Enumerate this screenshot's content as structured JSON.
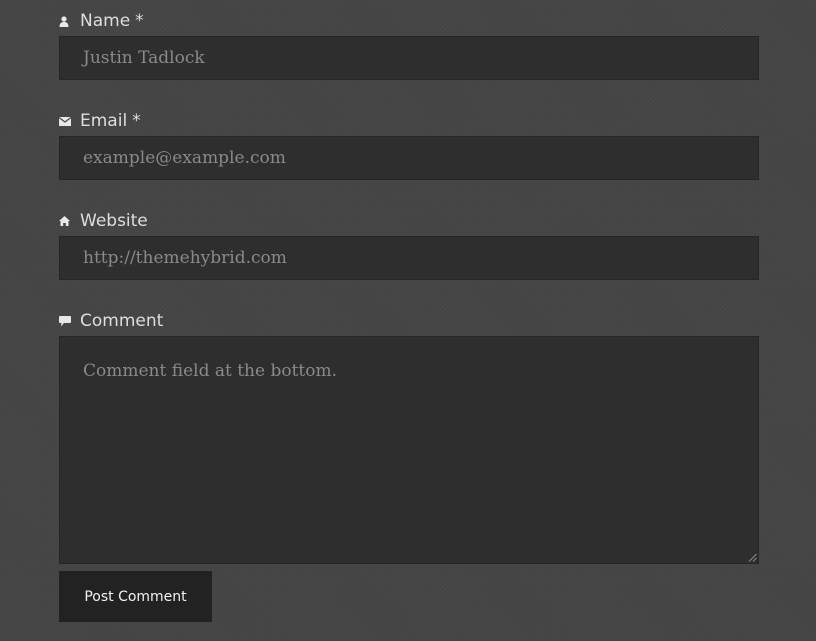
{
  "form": {
    "name": {
      "icon": "person-icon",
      "label": "Name",
      "required_mark": "*",
      "value": "Justin Tadlock"
    },
    "email": {
      "icon": "envelope-icon",
      "label": "Email",
      "required_mark": "*",
      "value": "example@example.com"
    },
    "website": {
      "icon": "home-icon",
      "label": "Website",
      "value": "http://themehybrid.com"
    },
    "comment": {
      "icon": "speech-bubble-icon",
      "label": "Comment",
      "value": "Comment field at the bottom."
    },
    "submit_label": "Post Comment"
  },
  "colors": {
    "background": "#454545",
    "field_background": "#2e2e2e",
    "label_text": "#dedede",
    "field_text": "#8a8a8a",
    "button_background": "#222222",
    "button_text": "#f2f2f2"
  }
}
